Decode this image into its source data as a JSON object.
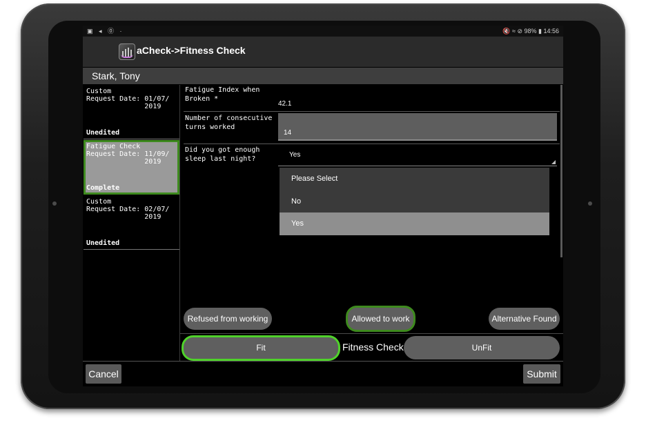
{
  "status_bar": {
    "left_icons": "▣ ◂ ⓪ ·",
    "right_text": "🔇 ≈ ⊘ 98% ▮ 14:56"
  },
  "app": {
    "logo_icon": "acheck-logo-icon",
    "title": "aCheck->Fitness Check"
  },
  "patient_name": "Stark, Tony",
  "requests": [
    {
      "type": "Custom",
      "date_label": "Request Date:",
      "date": "01/07/ 2019",
      "status": "Unedited",
      "selected": false
    },
    {
      "type": "Fatigue Check",
      "date_label": "Request Date:",
      "date": "11/09/ 2019",
      "status": "Complete",
      "selected": true
    },
    {
      "type": "Custom",
      "date_label": "Request Date:",
      "date": "02/07/ 2019",
      "status": "Unedited",
      "selected": false
    }
  ],
  "form": {
    "fatigue_index_label": "Fatigue Index when Broken *",
    "fatigue_index_value": "42.1",
    "turns_label": "Number of consecutive turns worked",
    "turns_value": "14",
    "sleep_label": "Did you got enough sleep last night?",
    "sleep_value": "Yes",
    "sleep_options": [
      "Please Select",
      "No",
      "Yes"
    ]
  },
  "work_buttons": {
    "refused": "Refused from working",
    "allowed": "Allowed to work",
    "alternative": "Alternative Found"
  },
  "fitness": {
    "fit": "Fit",
    "label": "Fitness Check",
    "unfit": "UnFit"
  },
  "footer": {
    "cancel": "Cancel",
    "submit": "Submit"
  },
  "colors": {
    "selected_border": "#3e8a1e",
    "fit_border": "#4fd22a",
    "app_bar": "#2b2b2b"
  }
}
